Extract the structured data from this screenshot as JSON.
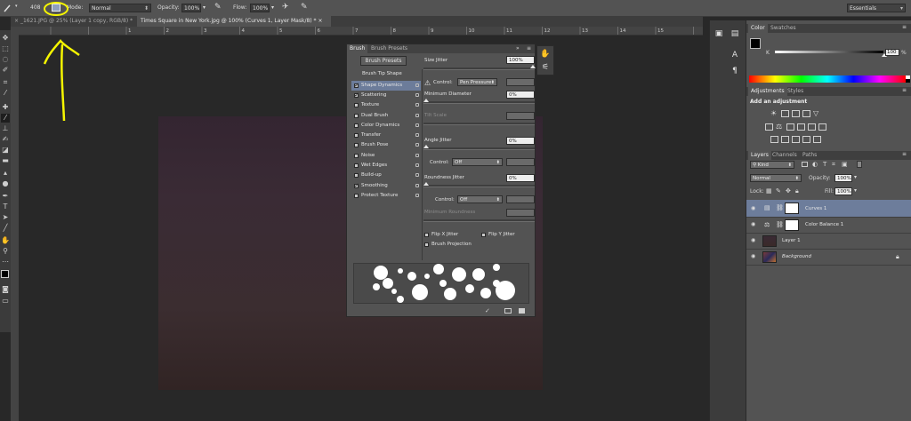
{
  "options_bar": {
    "brush_size": "408",
    "mode_label": "Mode:",
    "mode_value": "Normal",
    "opacity_label": "Opacity:",
    "opacity_value": "100%",
    "flow_label": "Flow:",
    "flow_value": "100%",
    "workspace": "Essentials"
  },
  "tabs": [
    {
      "label": "_1621.JPG @ 25% (Layer 1 copy, RGB/8) *",
      "active": false
    },
    {
      "label": "Times Square in New York.jpg @ 100% (Curves 1, Layer Mask/8) *",
      "active": true
    }
  ],
  "ruler_numbers": [
    "1",
    "2",
    "3",
    "4",
    "5",
    "6",
    "7",
    "8",
    "9",
    "10",
    "11",
    "12",
    "13",
    "14",
    "15"
  ],
  "brush_panel": {
    "tabs": [
      "Brush",
      "Brush Presets"
    ],
    "presets_button": "Brush Presets",
    "brush_tip_shape": "Brush Tip Shape",
    "options": [
      {
        "label": "Shape Dynamics",
        "checked": true,
        "selected": true
      },
      {
        "label": "Scattering",
        "checked": true,
        "selected": false
      },
      {
        "label": "Texture",
        "checked": false,
        "selected": false
      },
      {
        "label": "Dual Brush",
        "checked": false,
        "selected": false
      },
      {
        "label": "Color Dynamics",
        "checked": false,
        "selected": false
      },
      {
        "label": "Transfer",
        "checked": false,
        "selected": false
      },
      {
        "label": "Brush Pose",
        "checked": false,
        "selected": false
      },
      {
        "label": "Noise",
        "checked": false,
        "selected": false
      },
      {
        "label": "Wet Edges",
        "checked": false,
        "selected": false
      },
      {
        "label": "Build-up",
        "checked": false,
        "selected": false
      },
      {
        "label": "Smoothing",
        "checked": true,
        "selected": false
      },
      {
        "label": "Protect Texture",
        "checked": false,
        "selected": false
      }
    ],
    "size_jitter_label": "Size Jitter",
    "size_jitter_value": "100%",
    "control_label": "Control:",
    "control_value": "Pen Pressure",
    "min_diameter_label": "Minimum Diameter",
    "min_diameter_value": "0%",
    "tilt_scale_label": "Tilt Scale",
    "angle_jitter_label": "Angle Jitter",
    "angle_jitter_value": "0%",
    "angle_control_label": "Control:",
    "angle_control_value": "Off",
    "roundness_jitter_label": "Roundness Jitter",
    "roundness_jitter_value": "0%",
    "roundness_control_label": "Control:",
    "roundness_control_value": "Off",
    "min_roundness_label": "Minimum Roundness",
    "flip_x_label": "Flip X Jitter",
    "flip_y_label": "Flip Y Jitter",
    "brush_projection_label": "Brush Projection"
  },
  "color_panel": {
    "tabs": [
      "Color",
      "Swatches"
    ],
    "channel_label": "K",
    "channel_value": "100",
    "percent": "%"
  },
  "adjustments_panel": {
    "tabs": [
      "Adjustments",
      "Styles"
    ],
    "title": "Add an adjustment"
  },
  "layers_panel": {
    "tabs": [
      "Layers",
      "Channels",
      "Paths"
    ],
    "filter_value": "Kind",
    "blend_mode": "Normal",
    "opacity_label": "Opacity:",
    "opacity_value": "100%",
    "lock_label": "Lock:",
    "fill_label": "Fill:",
    "fill_value": "100%",
    "layers": [
      {
        "name": "Curves 1",
        "type": "curves",
        "selected": true
      },
      {
        "name": "Color Balance 1",
        "type": "balance",
        "selected": false
      },
      {
        "name": "Layer 1",
        "type": "pixel",
        "selected": false
      },
      {
        "name": "Background",
        "type": "background",
        "selected": false
      }
    ]
  },
  "colors": {
    "accent_selection": "#6d7d9b",
    "annotation": "#f5f500",
    "panel_bg": "#535353"
  }
}
